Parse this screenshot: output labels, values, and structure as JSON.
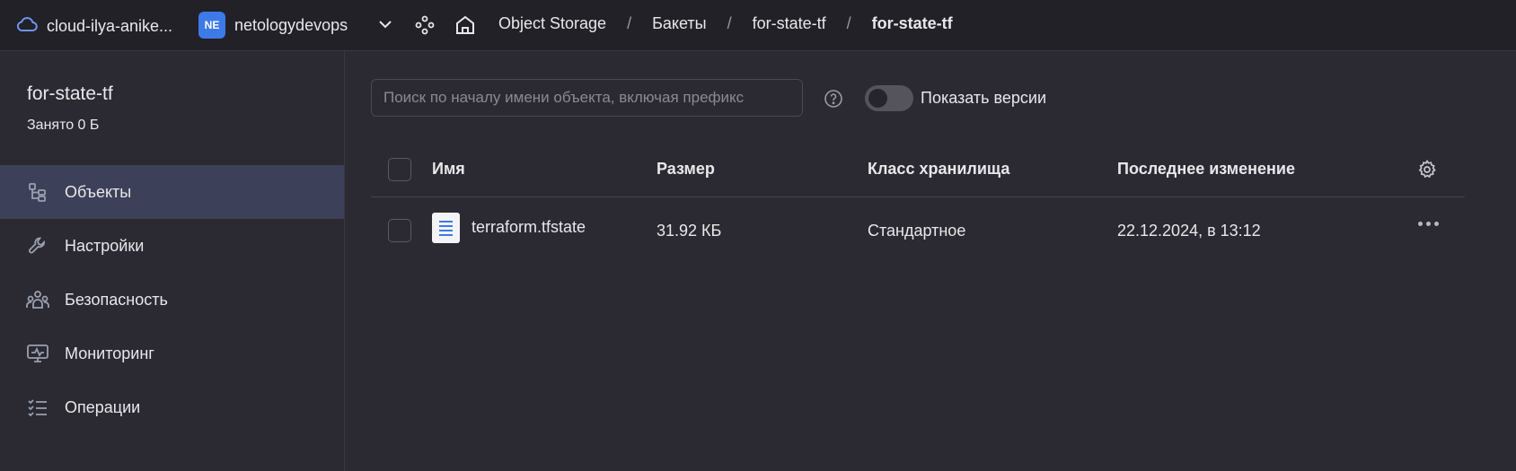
{
  "topbar": {
    "cloud_label": "cloud-ilya-anike...",
    "org_badge": "NE",
    "org_label": "netologydevops",
    "breadcrumbs": [
      "Object Storage",
      "Бакеты",
      "for-state-tf"
    ],
    "breadcrumb_current": "for-state-tf"
  },
  "sidebar": {
    "bucket_name": "for-state-tf",
    "usage": "Занято 0 Б",
    "items": [
      {
        "label": "Объекты",
        "icon": "objects-icon",
        "active": true
      },
      {
        "label": "Настройки",
        "icon": "wrench-icon"
      },
      {
        "label": "Безопасность",
        "icon": "people-icon"
      },
      {
        "label": "Мониторинг",
        "icon": "monitor-icon"
      },
      {
        "label": "Операции",
        "icon": "list-check-icon"
      }
    ]
  },
  "toolbar": {
    "search_placeholder": "Поиск по началу имени объекта, включая префикс",
    "show_versions_label": "Показать версии",
    "show_versions_on": false
  },
  "table": {
    "headers": {
      "name": "Имя",
      "size": "Размер",
      "storage_class": "Класс хранилища",
      "modified": "Последнее изменение"
    },
    "rows": [
      {
        "name": "terraform.tfstate",
        "size": "31.92 КБ",
        "storage_class": "Стандартное",
        "modified": "22.12.2024, в 13:12"
      }
    ]
  },
  "colors": {
    "accent": "#3d7ae8",
    "active_nav": "#3c4058",
    "background": "#2b2a33",
    "topbar": "#222127"
  }
}
